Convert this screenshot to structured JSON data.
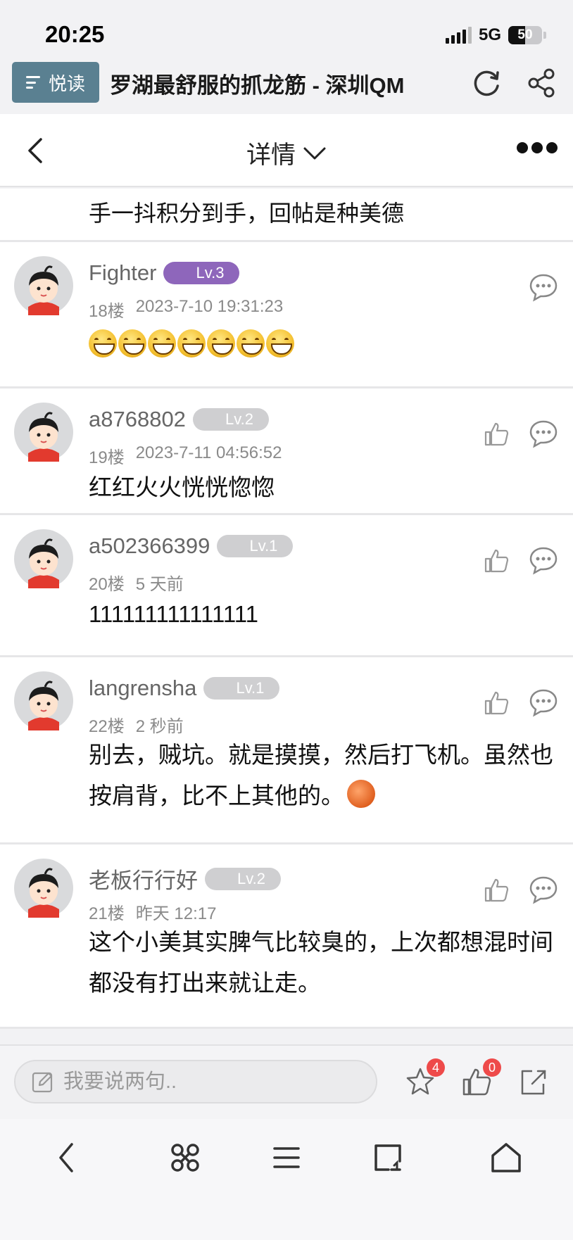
{
  "status_bar": {
    "time": "20:25",
    "network": "5G",
    "battery": "50",
    "battery_level": 0.5
  },
  "browser": {
    "reader_label": "悦读",
    "page_title": "罗湖最舒服的抓龙筋 - 深圳QM"
  },
  "header": {
    "title": "详情"
  },
  "partial_post": {
    "text": "手一抖积分到手，回帖是种美德"
  },
  "posts": [
    {
      "username": "Fighter",
      "level": "Lv.3",
      "floor": "18楼",
      "time": "2023-7-10 19:31:23",
      "text": "",
      "emoji_count": 7
    },
    {
      "username": "a8768802",
      "level": "Lv.2",
      "floor": "19楼",
      "time": "2023-7-11 04:56:52",
      "text": "红红火火恍恍惚惚"
    },
    {
      "username": "a502366399",
      "level": "Lv.1",
      "floor": "20楼",
      "time": "5 天前",
      "text": "111111111111111"
    },
    {
      "username": "langrensha",
      "level": "Lv.1",
      "floor": "22楼",
      "time": "2 秒前",
      "text": "别去，贼坑。就是摸摸，然后打飞机。虽然也按肩背，比不上其他的。"
    },
    {
      "username": "老板行行好",
      "level": "Lv.2",
      "floor": "21楼",
      "time": "昨天 12:17",
      "text": "这个小美其实脾气比较臭的，上次都想混时间都没有打出来就让走。"
    }
  ],
  "input_bar": {
    "placeholder": "我要说两句..",
    "favorite_count": "4",
    "like_count": "0"
  },
  "colors": {
    "reader_button": "#5a8091",
    "level_purple": "#8e66bb",
    "level_gray": "#cfcfd1",
    "badge_red": "#ee4a4a"
  },
  "icons": [
    "signal-icon",
    "battery-icon",
    "menu-icon",
    "refresh-icon",
    "share-icon",
    "back-chevron-icon",
    "chevron-down-icon",
    "more-dots-icon",
    "like-icon",
    "comment-icon",
    "edit-icon",
    "star-icon",
    "thumb-up-icon",
    "share-out-icon",
    "browser-back-icon",
    "apps-icon",
    "menu-lines-icon",
    "tabs-icon",
    "home-icon"
  ]
}
